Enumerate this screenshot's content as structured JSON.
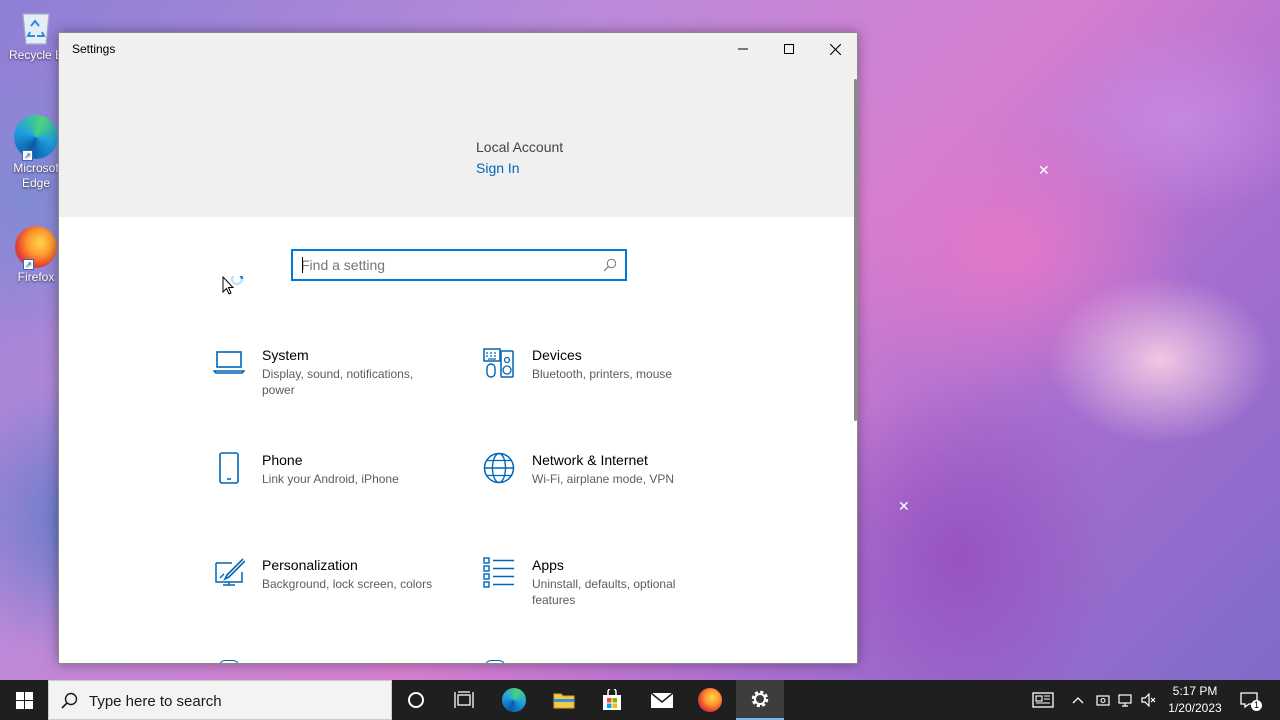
{
  "desktop": {
    "icons": [
      {
        "label": "Recycle Bin",
        "visible_label": "Recycle B"
      },
      {
        "label": "Microsoft Edge",
        "line1": "Microsof",
        "line2": "Edge"
      },
      {
        "label": "Firefox"
      }
    ]
  },
  "window": {
    "title": "Settings",
    "controls": [
      "minimize-icon",
      "maximize-icon",
      "close-icon"
    ]
  },
  "account": {
    "name": "Local Account",
    "sign_in": "Sign In"
  },
  "search": {
    "placeholder": "Find a setting",
    "value": ""
  },
  "categories": [
    {
      "title": "System",
      "description": "Display, sound, notifications, power",
      "icon": "laptop-icon"
    },
    {
      "title": "Devices",
      "description": "Bluetooth, printers, mouse",
      "icon": "devices-icon"
    },
    {
      "title": "Phone",
      "description": "Link your Android, iPhone",
      "icon": "phone-icon"
    },
    {
      "title": "Network & Internet",
      "description": "Wi-Fi, airplane mode, VPN",
      "icon": "globe-icon"
    },
    {
      "title": "Personalization",
      "description": "Background, lock screen, colors",
      "icon": "paint-icon"
    },
    {
      "title": "Apps",
      "description": "Uninstall, defaults, optional features",
      "icon": "apps-list-icon"
    }
  ],
  "taskbar": {
    "search_placeholder": "Type here to search",
    "time": "5:17 PM",
    "date": "1/20/2023",
    "notification_count": "1",
    "accent": "#76b9ed"
  },
  "colors": {
    "accent": "#0067b8",
    "focus_border": "#0078d7"
  }
}
